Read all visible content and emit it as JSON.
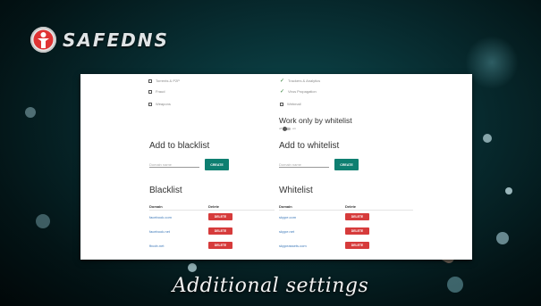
{
  "brand": {
    "name": "SAFEDNS",
    "logo_icon": "shield-figure-icon"
  },
  "options": {
    "left": [
      {
        "label": "Torrents & P2P",
        "state": "unchecked"
      },
      {
        "label": "Fraud",
        "state": "unchecked"
      },
      {
        "label": "Weapons",
        "state": "unchecked"
      }
    ],
    "right": [
      {
        "label": "Trackers & Analytics",
        "state": "checked"
      },
      {
        "label": "Virus Propagation",
        "state": "checked"
      },
      {
        "label": "Webmail",
        "state": "unchecked"
      }
    ]
  },
  "whitelist_mode": {
    "title": "Work only by whitelist",
    "off_label": "off",
    "on_label": "on"
  },
  "blacklist_form": {
    "title": "Add to blacklist",
    "placeholder": "Domain name",
    "button": "CREATE"
  },
  "whitelist_form": {
    "title": "Add to whitelist",
    "placeholder": "Domain name",
    "button": "CREATE"
  },
  "blacklist": {
    "title": "Blacklist",
    "columns": [
      "Domain",
      "Delete"
    ],
    "rows": [
      {
        "domain": "facebook.com",
        "action": "DELETE"
      },
      {
        "domain": "facebook.net",
        "action": "DELETE"
      },
      {
        "domain": "fbcdn.net",
        "action": "DELETE"
      }
    ]
  },
  "whitelist": {
    "title": "Whitelist",
    "columns": [
      "Domain",
      "Delete"
    ],
    "rows": [
      {
        "domain": "skype.com",
        "action": "DELETE"
      },
      {
        "domain": "skype.net",
        "action": "DELETE"
      },
      {
        "domain": "skypeassets.com",
        "action": "DELETE"
      }
    ]
  },
  "caption": "Additional settings",
  "colors": {
    "accent": "#0e7f71",
    "danger": "#d63b3b",
    "link": "#3d79b9"
  }
}
